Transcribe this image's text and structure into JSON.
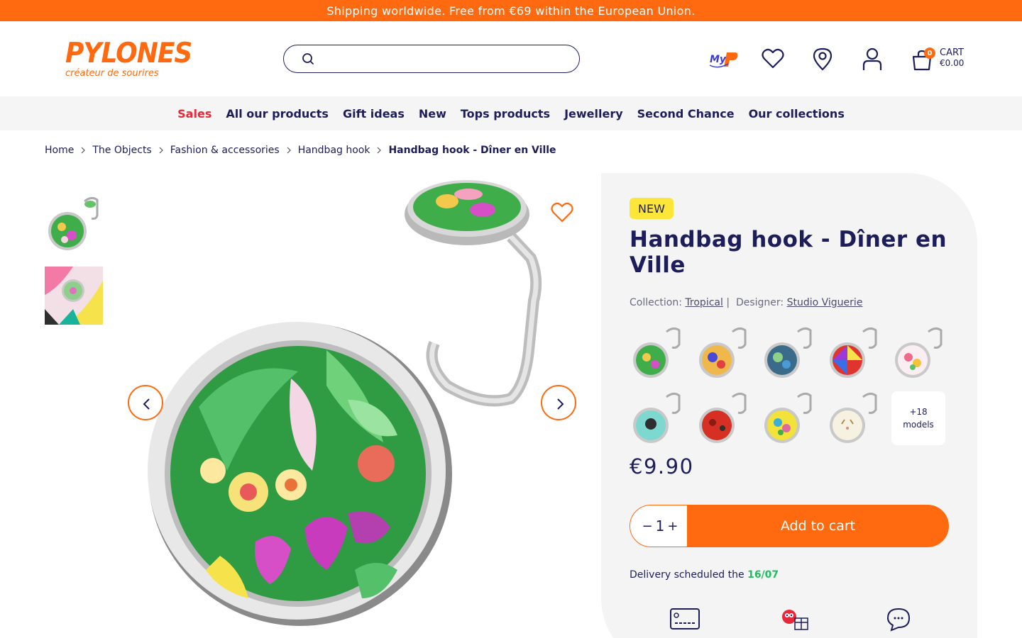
{
  "announcement": "Shipping worldwide. Free from €69 within the European Union.",
  "header": {
    "logo_text": "PYLONES",
    "logo_tagline": "créateur de sourires",
    "search_placeholder": "",
    "cart": {
      "count": "0",
      "label": "CART",
      "total": "€0.00"
    },
    "icons": [
      "my-pylones-icon",
      "heart-icon",
      "location-icon",
      "user-icon",
      "cart-icon"
    ]
  },
  "nav": {
    "items": [
      "Sales",
      "All our products",
      "Gift ideas",
      "New",
      "Tops products",
      "Jewellery",
      "Second Chance",
      "Our collections"
    ]
  },
  "breadcrumb": [
    "Home",
    "The Objects",
    "Fashion & accessories",
    "Handbag hook",
    "Handbag hook - Dîner en Ville"
  ],
  "product": {
    "badge": "NEW",
    "title": "Handbag hook - Dîner en Ville",
    "collection_label": "Collection:",
    "collection": "Tropical",
    "separator": "|",
    "designer_label": "Designer:",
    "designer": "Studio Viguerie",
    "more_models_count": "+18",
    "more_models_label": "models",
    "price": "€9.90",
    "quantity": "1",
    "qty_minus": "−",
    "qty_plus": "+",
    "add_to_cart": "Add to cart",
    "delivery_text": "Delivery scheduled the",
    "delivery_date": "16/07"
  },
  "colors": {
    "accent": "#ff6a10",
    "navy": "#1d1d5c",
    "sale_red": "#e8283a",
    "new_badge": "#fde63a",
    "delivery_green": "#1fbf5f"
  }
}
